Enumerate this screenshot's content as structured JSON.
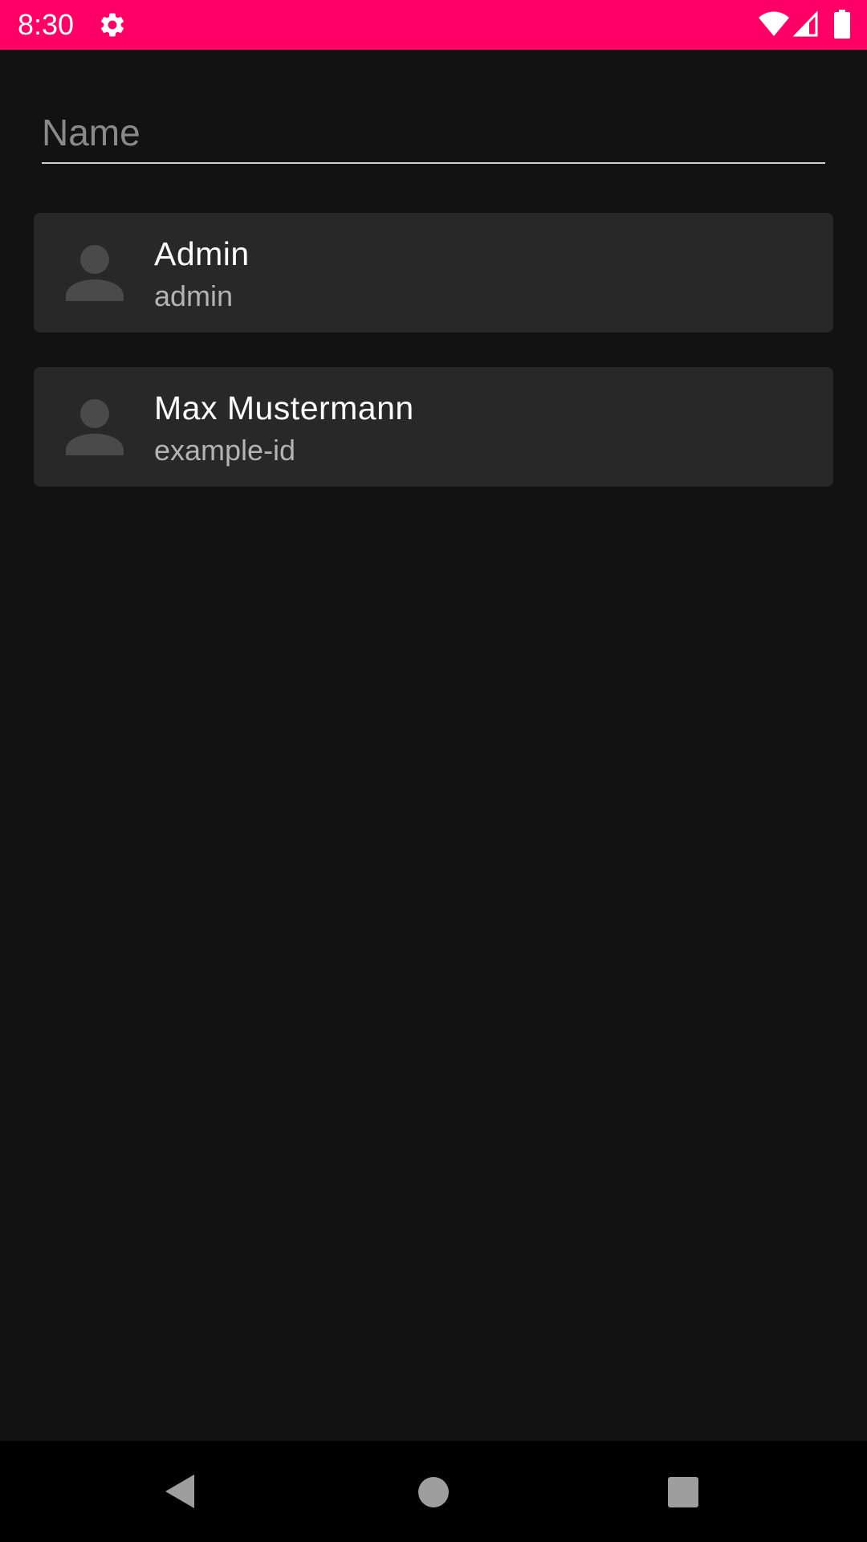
{
  "status_bar": {
    "time": "8:30",
    "background_color": "#ff0066",
    "icons": [
      "gear-icon",
      "wifi-icon",
      "signal-icon",
      "battery-icon"
    ]
  },
  "search": {
    "placeholder": "Name",
    "value": ""
  },
  "users": [
    {
      "name": "Admin",
      "id": "admin",
      "avatar_icon": "person-icon"
    },
    {
      "name": "Max Mustermann",
      "id": "example-id",
      "avatar_icon": "person-icon"
    }
  ],
  "nav_bar": {
    "icons": [
      "back-icon",
      "home-icon",
      "recents-icon"
    ]
  }
}
